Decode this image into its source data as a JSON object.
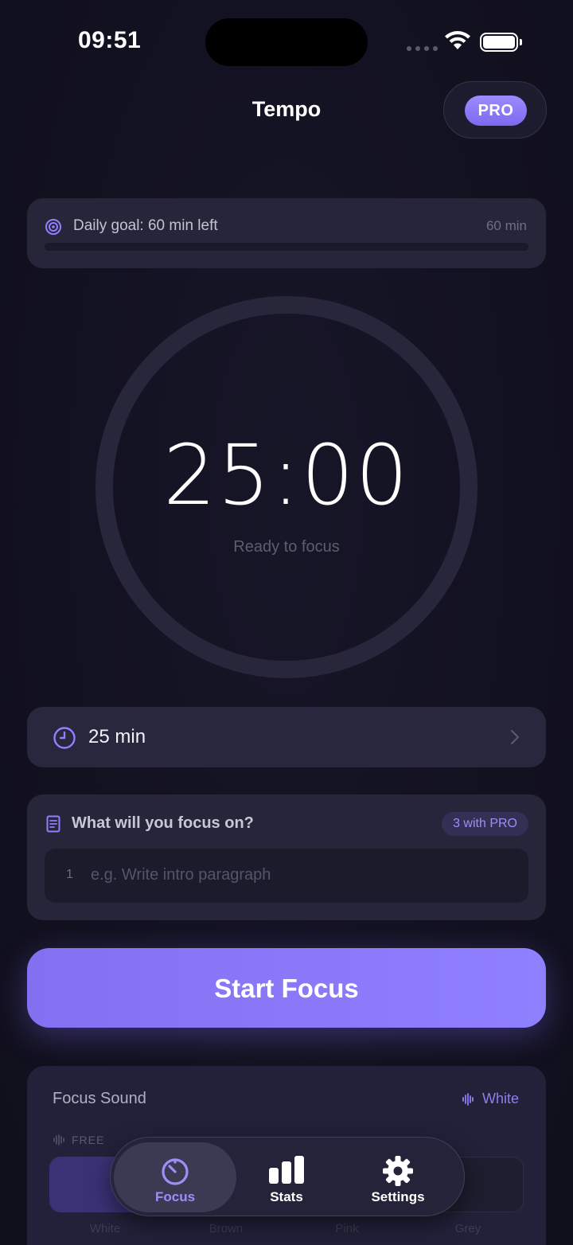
{
  "status_bar": {
    "time": "09:51"
  },
  "header": {
    "title": "Tempo",
    "pro_label": "PRO"
  },
  "daily_goal": {
    "label": "Daily goal: 60 min left",
    "amount": "60 min",
    "progress": 0
  },
  "timer": {
    "value": "25:00",
    "status": "Ready to focus"
  },
  "duration": {
    "label": "25 min"
  },
  "task": {
    "label": "What will you focus on?",
    "pro_chip": "3 with PRO",
    "row_number": "1",
    "placeholder": "e.g. Write intro paragraph"
  },
  "start_button": {
    "label": "Start Focus"
  },
  "focus_sound": {
    "title": "Focus Sound",
    "current": "White",
    "free_label": "FREE",
    "options": [
      "White",
      "Brown",
      "Pink",
      "Grey"
    ]
  },
  "tabs": [
    {
      "label": "Focus",
      "icon": "timer-icon"
    },
    {
      "label": "Stats",
      "icon": "bar-chart-icon"
    },
    {
      "label": "Settings",
      "icon": "gear-icon"
    }
  ],
  "colors": {
    "accent": "#8f80ff",
    "background": "#13121f",
    "card": "#26253a"
  }
}
